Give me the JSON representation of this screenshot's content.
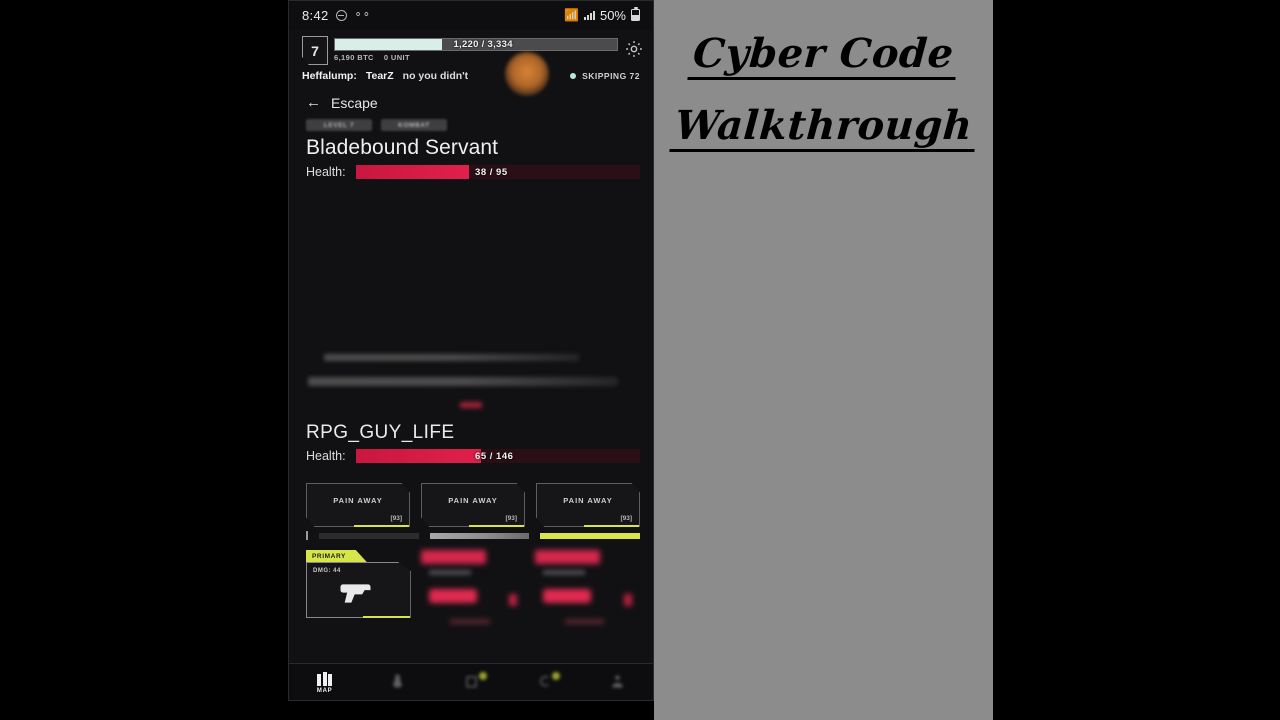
{
  "overlay": {
    "title_line1": "Cyber Code",
    "title_line2": "Walkthrough",
    "background_color": "#8c8c8c",
    "text_color": "#000000"
  },
  "status_bar": {
    "clock": "8:42",
    "dnd_icon": "do-not-disturb-icon",
    "glasses_icon": "glasses-icon",
    "wifi_off_icon": "wifi-off-icon",
    "signal_icon": "signal-bars-icon",
    "battery_percent": "50%",
    "battery_icon": "battery-icon"
  },
  "header": {
    "level": "7",
    "xp_current": "1,220",
    "xp_max": "3,334",
    "xp_text": "1,220 / 3,334",
    "xp_fill_percent": 38,
    "currency_btc": "6,190 BTC",
    "currency_unit": "0 UNIT",
    "settings_icon": "gear-icon",
    "touch_indicator": "touch-point-indicator"
  },
  "chat": {
    "username": "Heffalump:",
    "target": "TearZ",
    "message": "no you didn't",
    "status_label": "SKIPPING 72",
    "status_dot_color": "#b7e9d8"
  },
  "nav": {
    "back_icon": "arrow-left-icon",
    "back_label": "Escape"
  },
  "enemy": {
    "tags": [
      "LEVEL 7",
      "KOMBAT"
    ],
    "name": "Bladebound Servant",
    "health_label": "Health:",
    "health_text": "38 / 95",
    "health_current": 38,
    "health_max": 95,
    "health_fill_percent": 40,
    "health_color": "#e0204a"
  },
  "combat_log": {
    "line_1": "",
    "line_2": "",
    "blurred": "true"
  },
  "player": {
    "name": "RPG_GUY_LIFE",
    "health_label": "Health:",
    "health_text": "65 / 146",
    "health_current": 65,
    "health_max": 146,
    "health_fill_percent": 44,
    "health_color": "#e0204a"
  },
  "items": [
    {
      "name": "PAIN AWAY",
      "qty": "[93]"
    },
    {
      "name": "PAIN AWAY",
      "qty": "[93]"
    },
    {
      "name": "PAIN AWAY",
      "qty": "[93]"
    }
  ],
  "weapons": {
    "primary_tab": "PRIMARY",
    "primary_label": "DMG: 44",
    "primary_icon": "pistol-icon",
    "slot_2": "",
    "slot_3": "",
    "accent_color": "#d6e54a"
  },
  "bottom_nav": [
    {
      "label": "MAP",
      "icon": "map-icon",
      "active": true,
      "badge": false
    },
    {
      "label": "",
      "icon": "potion-icon",
      "active": false,
      "badge": false
    },
    {
      "label": "",
      "icon": "inventory-icon",
      "active": false,
      "badge": true
    },
    {
      "label": "",
      "icon": "quests-icon",
      "active": false,
      "badge": true
    },
    {
      "label": "",
      "icon": "character-icon",
      "active": false,
      "badge": false
    }
  ]
}
